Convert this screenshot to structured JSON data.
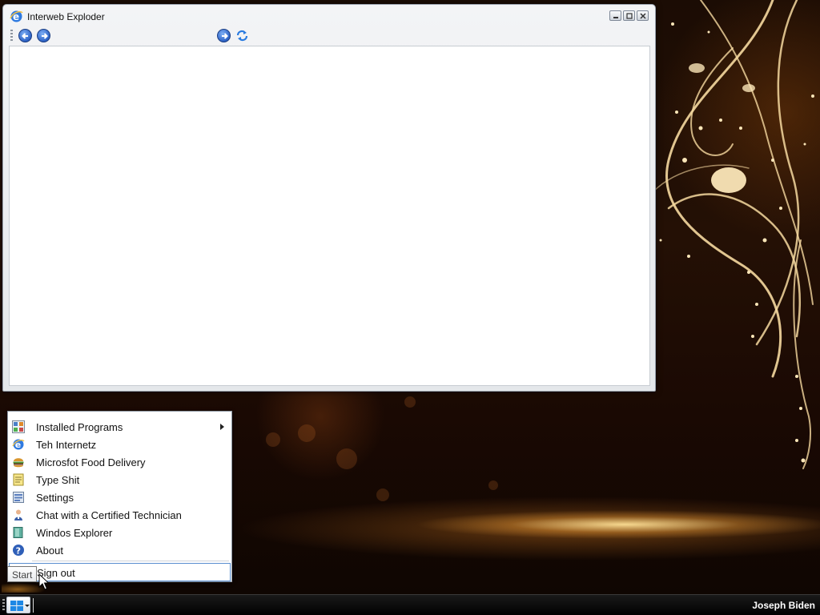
{
  "browser": {
    "title": "Interweb Exploder"
  },
  "start_menu": {
    "items": [
      {
        "label": "Installed Programs",
        "icon": "installed-programs-icon",
        "submenu": true
      },
      {
        "label": "Teh Internetz",
        "icon": "internet-browser-icon"
      },
      {
        "label": "Microsfot Food Delivery",
        "icon": "burger-icon"
      },
      {
        "label": "Type Shit",
        "icon": "notepad-icon"
      },
      {
        "label": "Settings",
        "icon": "settings-icon"
      },
      {
        "label": "Chat with a Certified Technician",
        "icon": "technician-icon"
      },
      {
        "label": "Windos Explorer",
        "icon": "file-explorer-icon"
      },
      {
        "label": "About",
        "icon": "help-icon"
      }
    ],
    "sign_out": "Sign out"
  },
  "tooltip": {
    "text": "Start"
  },
  "taskbar": {
    "username": "Joseph Biden"
  },
  "colors": {
    "accent": "#2c62c6",
    "taskbar": "#000000",
    "wallpaper_glow": "#ffb84a"
  }
}
